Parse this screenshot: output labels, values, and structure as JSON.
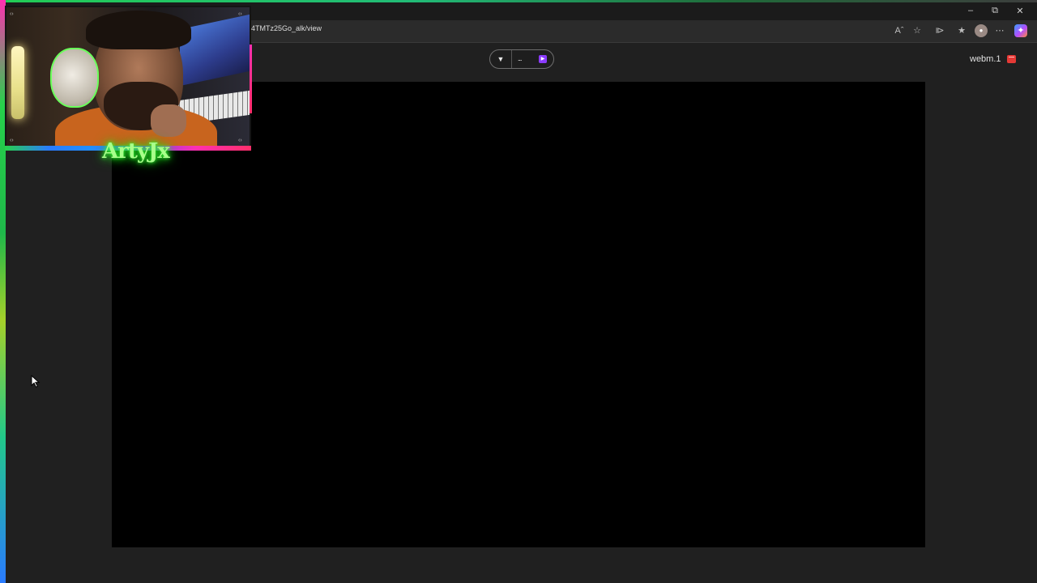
{
  "browser": {
    "url_visible": "4TMTz25Go_alk/view",
    "window_controls": [
      "minimize-icon",
      "restore-icon",
      "close-icon"
    ],
    "toolbar_icons": [
      "read-aloud-icon",
      "favorite-star-icon",
      "extensions-icon",
      "favorites-icon",
      "profile-avatar-icon",
      "more-icon",
      "copilot-icon"
    ]
  },
  "viewer": {
    "pill_dropdown_icon": "caret-down-icon",
    "pill_mid_text": "...",
    "pill_badge_icon": "video-badge-icon",
    "filename": "webm.1",
    "file_type_icon": "video-file-icon"
  },
  "webcam_overlay": {
    "streamer_name": "ArtyJx"
  },
  "colors": {
    "background": "#202020",
    "video": "#000000",
    "rgb_green": "#27d14b",
    "rgb_pink": "#ff2fb0",
    "rgb_blue": "#2a7bff",
    "file_icon_red": "#e53935",
    "badge_purple": "#8c3cff"
  }
}
